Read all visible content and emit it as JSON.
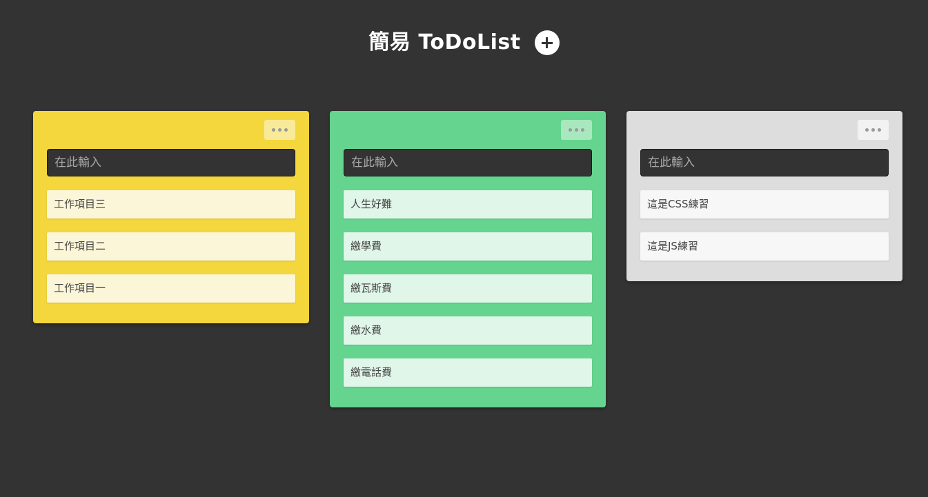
{
  "header": {
    "title": "簡易 ToDoList",
    "add_icon": "plus-icon"
  },
  "notes": [
    {
      "color": "yellow",
      "menu_icon": "more-horizontal-icon",
      "input_placeholder": "在此輸入",
      "items": [
        "工作項目三",
        "工作項目二",
        "工作項目一"
      ]
    },
    {
      "color": "green",
      "menu_icon": "more-horizontal-icon",
      "input_placeholder": "在此輸入",
      "items": [
        "人生好難",
        "繳學費",
        "繳瓦斯費",
        "繳水費",
        "繳電話費"
      ]
    },
    {
      "color": "gray",
      "menu_icon": "more-horizontal-icon",
      "input_placeholder": "在此輸入",
      "items": [
        "這是CSS練習",
        "這是JS練習"
      ]
    }
  ],
  "colors": {
    "background": "#333333",
    "yellow": "#f3d73d",
    "green": "#65d48f",
    "gray": "#dddddd"
  }
}
